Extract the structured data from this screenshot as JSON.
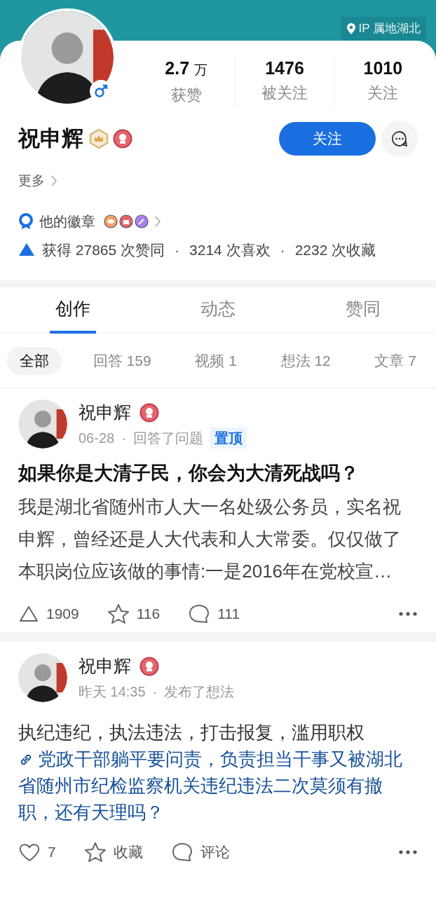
{
  "header": {
    "ip_location": "IP 属地湖北"
  },
  "profile": {
    "name": "祝申辉",
    "more": "更多",
    "follow_button": "关注",
    "badges_label": "他的徽章",
    "stats": [
      {
        "value": "2.7",
        "unit": "万",
        "label": "获赞"
      },
      {
        "value": "1476",
        "label": "被关注"
      },
      {
        "value": "1010",
        "label": "关注"
      }
    ],
    "achievements": [
      {
        "text": "获得 27865 次赞同"
      },
      {
        "separator": "·",
        "text": "3214 次喜欢"
      },
      {
        "separator": "·",
        "text": "2232 次收藏"
      }
    ]
  },
  "tabs": [
    {
      "label": "创作",
      "selected": true
    },
    {
      "label": "动态",
      "selected": false
    },
    {
      "label": "赞同",
      "selected": false
    }
  ],
  "filters": [
    {
      "label": "全部",
      "selected": true
    },
    {
      "label": "回答 159",
      "selected": false
    },
    {
      "label": "视频 1",
      "selected": false
    },
    {
      "label": "想法 12",
      "selected": false
    },
    {
      "label": "文章 7",
      "selected": false
    }
  ],
  "posts": [
    {
      "kind": "answer",
      "author": "祝申辉",
      "time": "06-28",
      "separator": "·",
      "action": "回答了问题",
      "pinned": "置顶",
      "title": "如果你是大清子民，你会为大清死战吗？",
      "body": "我是湖北省随州市人大一名处级公务员，实名祝申辉，曾经还是人大代表和人大常委。仅仅做了本职岗位应该做的事情:一是2016年在党校宣…",
      "actions": [
        {
          "kind": "upvote",
          "text": "1909"
        },
        {
          "kind": "star",
          "text": "116"
        },
        {
          "kind": "comment",
          "text": "111"
        }
      ]
    },
    {
      "kind": "thought",
      "author": "祝申辉",
      "time": "昨天 14:35",
      "separator": "·",
      "action": "发布了想法",
      "body": "执纪违纪，执法违法，打击报复，滥用职权",
      "link": "党政干部躺平要问责，负责担当干事又被湖北省随州市纪检监察机关违纪违法二次莫须有撤职，还有天理吗？",
      "actions": [
        {
          "kind": "heart",
          "text": "7"
        },
        {
          "kind": "star",
          "text": "收藏"
        },
        {
          "kind": "comment",
          "text": "评论"
        }
      ]
    }
  ]
}
